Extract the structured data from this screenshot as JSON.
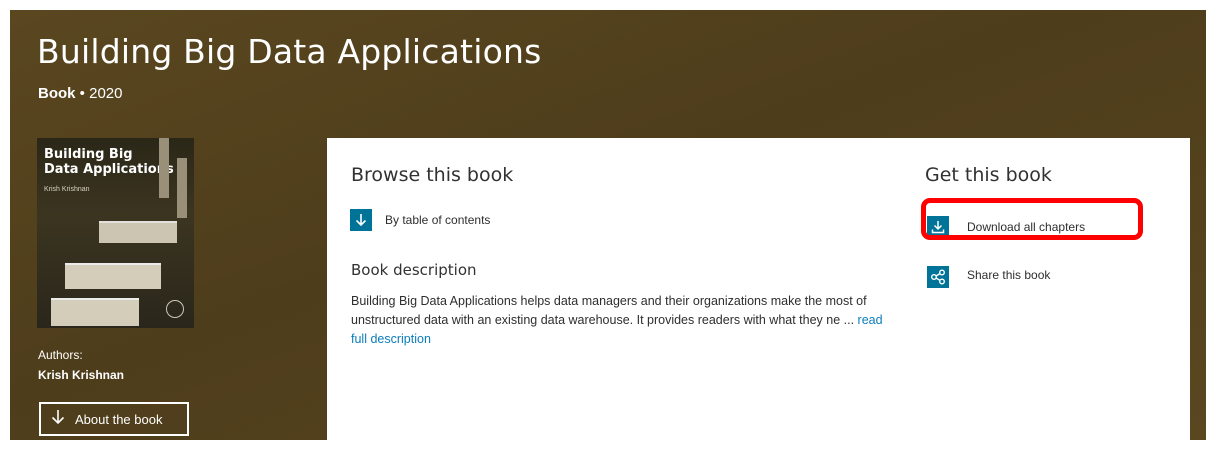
{
  "header": {
    "title": "Building Big Data Applications",
    "type": "Book",
    "separator": "•",
    "year": "2020"
  },
  "cover": {
    "title": "Building Big\nData Applications",
    "author": "Krish Krishnan"
  },
  "authors": {
    "label": "Authors:",
    "names": [
      "Krish Krishnan"
    ]
  },
  "about_button": {
    "label": "About the book",
    "icon": "arrow-down-icon"
  },
  "browse": {
    "heading": "Browse this book",
    "toc_label": "By table of contents",
    "toc_icon": "arrow-down-icon"
  },
  "description": {
    "heading": "Book description",
    "text": "Building Big Data Applications helps data managers and their organizations make the most of unstructured data with an existing data warehouse. It provides readers with what they ne ...",
    "more_link": "read full description"
  },
  "get_book": {
    "heading": "Get this book",
    "download_label": "Download all chapters",
    "download_icon": "download-icon",
    "share_label": "Share this book",
    "share_icon": "share-icon"
  },
  "colors": {
    "hero_bg": "#5a4720",
    "accent": "#007398",
    "link": "#0c7dbb",
    "highlight": "#ff0000"
  }
}
